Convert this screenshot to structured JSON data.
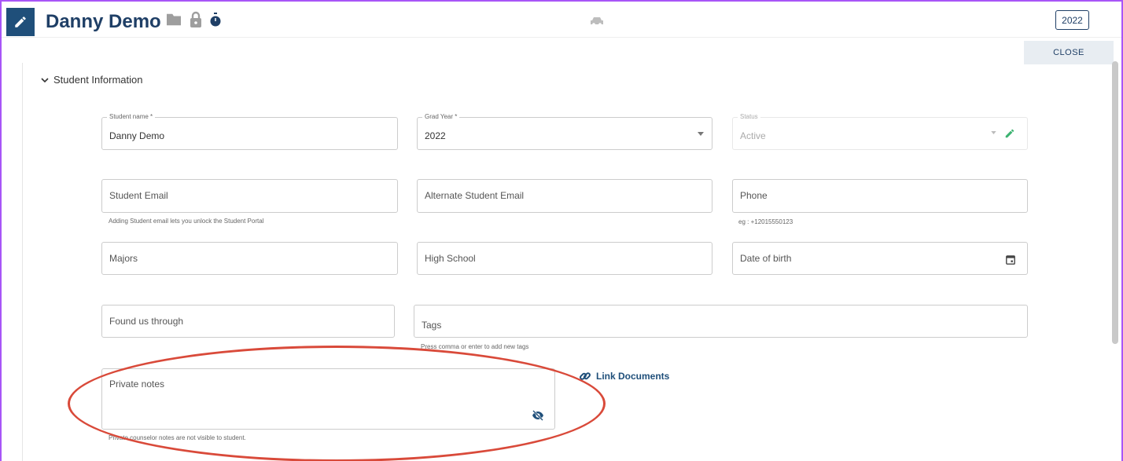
{
  "header": {
    "title": "Danny Demo",
    "year_badge": "2022"
  },
  "close_label": "CLOSE",
  "section": {
    "title": "Student Information"
  },
  "fields": {
    "student_name": {
      "label": "Student name *",
      "value": "Danny Demo"
    },
    "grad_year": {
      "label": "Grad Year *",
      "value": "2022"
    },
    "status": {
      "label": "Status",
      "value": "Active"
    },
    "student_email": {
      "placeholder": "Student Email",
      "helper": "Adding Student email lets you unlock the Student Portal"
    },
    "alt_email": {
      "placeholder": "Alternate Student Email"
    },
    "phone": {
      "placeholder": "Phone",
      "helper": "eg : +12015550123"
    },
    "majors": {
      "placeholder": "Majors"
    },
    "high_school": {
      "placeholder": "High School"
    },
    "dob": {
      "placeholder": "Date of birth"
    },
    "found_us": {
      "placeholder": "Found us through"
    },
    "tags": {
      "placeholder": "Tags",
      "helper": "Press comma or enter to add new tags"
    },
    "private_notes": {
      "placeholder": "Private notes",
      "helper": "Private counselor notes are not visible to student."
    }
  },
  "link_documents": "Link Documents",
  "colors": {
    "accent": "#1f4f7a",
    "highlight": "#d94a3a",
    "frame": "#a855f7"
  }
}
